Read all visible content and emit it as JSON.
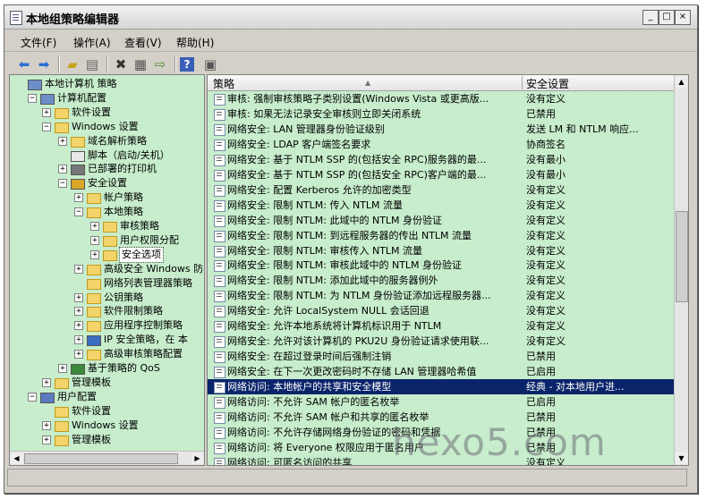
{
  "window": {
    "title": "本地组策略编辑器",
    "controls": [
      "_",
      "□",
      "×"
    ]
  },
  "menu": [
    {
      "label": "文件(F)"
    },
    {
      "label": "操作(A)"
    },
    {
      "label": "查看(V)"
    },
    {
      "label": "帮助(H)"
    }
  ],
  "tree": [
    {
      "label": "本地计算机 策略",
      "icon": "computer-icon",
      "expander": ""
    },
    {
      "label": "计算机配置",
      "icon": "computer-icon",
      "expander": "−"
    },
    {
      "label": "软件设置",
      "icon": "folder-icon",
      "expander": "+"
    },
    {
      "label": "Windows 设置",
      "icon": "folder-icon",
      "expander": "−"
    },
    {
      "label": "域名解析策略",
      "icon": "folder-icon",
      "expander": "+"
    },
    {
      "label": "脚本（启动/关机）",
      "icon": "script-icon",
      "expander": ""
    },
    {
      "label": "已部署的打印机",
      "icon": "printer-icon",
      "expander": "+"
    },
    {
      "label": "安全设置",
      "icon": "security-icon",
      "expander": "−"
    },
    {
      "label": "帐户策略",
      "icon": "folder-icon",
      "expander": "+"
    },
    {
      "label": "本地策略",
      "icon": "folder-icon",
      "expander": "−"
    },
    {
      "label": "审核策略",
      "icon": "folder-icon",
      "expander": "+"
    },
    {
      "label": "用户权限分配",
      "icon": "folder-icon",
      "expander": "+"
    },
    {
      "label": "安全选项",
      "icon": "folder-icon",
      "expander": "+"
    },
    {
      "label": "高级安全 Windows 防",
      "icon": "folder-icon",
      "expander": "+"
    },
    {
      "label": "网络列表管理器策略",
      "icon": "folder-icon",
      "expander": ""
    },
    {
      "label": "公钥策略",
      "icon": "folder-icon",
      "expander": "+"
    },
    {
      "label": "软件限制策略",
      "icon": "folder-icon",
      "expander": "+"
    },
    {
      "label": "应用程序控制策略",
      "icon": "folder-icon",
      "expander": "+"
    },
    {
      "label": "IP 安全策略，在 本",
      "icon": "ipsec-icon",
      "expander": "+"
    },
    {
      "label": "高级审核策略配置",
      "icon": "folder-icon",
      "expander": "+"
    },
    {
      "label": "基于策略的 QoS",
      "icon": "chart-icon",
      "expander": "+"
    },
    {
      "label": "管理模板",
      "icon": "folder-icon",
      "expander": "+"
    },
    {
      "label": "用户配置",
      "icon": "user-icon",
      "expander": "−"
    },
    {
      "label": "软件设置",
      "icon": "folder-icon",
      "expander": ""
    },
    {
      "label": "Windows 设置",
      "icon": "folder-icon",
      "expander": "+"
    },
    {
      "label": "管理模板",
      "icon": "folder-icon",
      "expander": "+"
    }
  ],
  "list": {
    "columns": [
      "策略",
      "安全设置"
    ],
    "rows": [
      {
        "policy": "审核: 强制审核策略子类别设置(Windows Vista 或更高版...",
        "setting": "没有定义"
      },
      {
        "policy": "审核: 如果无法记录安全审核则立即关闭系统",
        "setting": "已禁用"
      },
      {
        "policy": "网络安全: LAN 管理器身份验证级别",
        "setting": "发送 LM 和 NTLM 响应..."
      },
      {
        "policy": "网络安全: LDAP 客户端签名要求",
        "setting": "协商签名"
      },
      {
        "policy": "网络安全: 基于 NTLM SSP 的(包括安全 RPC)服务器的最...",
        "setting": "没有最小"
      },
      {
        "policy": "网络安全: 基于 NTLM SSP 的(包括安全 RPC)客户端的最...",
        "setting": "没有最小"
      },
      {
        "policy": "网络安全: 配置 Kerberos 允许的加密类型",
        "setting": "没有定义"
      },
      {
        "policy": "网络安全: 限制 NTLM: 传入 NTLM 流量",
        "setting": "没有定义"
      },
      {
        "policy": "网络安全: 限制 NTLM: 此域中的 NTLM 身份验证",
        "setting": "没有定义"
      },
      {
        "policy": "网络安全: 限制 NTLM: 到远程服务器的传出 NTLM 流量",
        "setting": "没有定义"
      },
      {
        "policy": "网络安全: 限制 NTLM: 审核传入 NTLM 流量",
        "setting": "没有定义"
      },
      {
        "policy": "网络安全: 限制 NTLM: 审核此域中的 NTLM 身份验证",
        "setting": "没有定义"
      },
      {
        "policy": "网络安全: 限制 NTLM: 添加此域中的服务器例外",
        "setting": "没有定义"
      },
      {
        "policy": "网络安全: 限制 NTLM: 为 NTLM 身份验证添加远程服务器...",
        "setting": "没有定义"
      },
      {
        "policy": "网络安全: 允许 LocalSystem NULL 会话回退",
        "setting": "没有定义"
      },
      {
        "policy": "网络安全: 允许本地系统将计算机标识用于 NTLM",
        "setting": "没有定义"
      },
      {
        "policy": "网络安全: 允许对该计算机的 PKU2U 身份验证请求使用联...",
        "setting": "没有定义"
      },
      {
        "policy": "网络安全: 在超过登录时间后强制注销",
        "setting": "已禁用"
      },
      {
        "policy": "网络安全: 在下一次更改密码时不存储 LAN 管理器哈希值",
        "setting": "已启用"
      },
      {
        "policy": "网络访问: 本地帐户的共享和安全模型",
        "setting": "经典 - 对本地用户进...",
        "selected": true
      },
      {
        "policy": "网络访问: 不允许 SAM 帐户的匿名枚举",
        "setting": "已启用"
      },
      {
        "policy": "网络访问: 不允许 SAM 帐户和共享的匿名枚举",
        "setting": "已禁用"
      },
      {
        "policy": "网络访问: 不允许存储网络身份验证的密码和凭据",
        "setting": "已禁用"
      },
      {
        "policy": "网络访问: 将 Everyone 权限应用于匿名用户",
        "setting": "已禁用"
      },
      {
        "policy": "网络访问: 可匿名访问的共享",
        "setting": "没有定义"
      }
    ]
  },
  "watermark": "hexo5.com",
  "colors": {
    "pane_bg": "#c7edcc",
    "selection": "#0a246a",
    "chrome": "#d4d0c8"
  }
}
